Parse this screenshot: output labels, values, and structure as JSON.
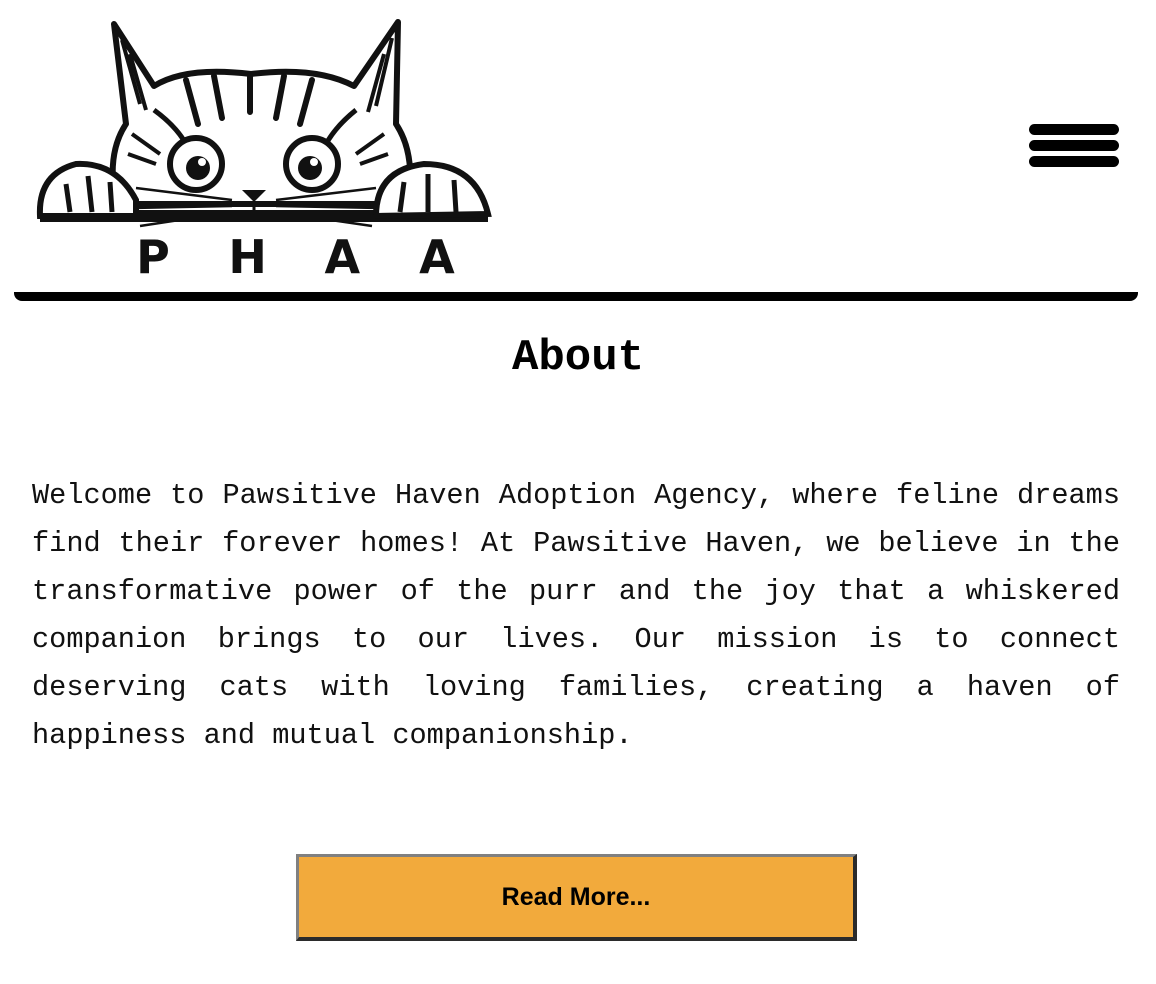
{
  "header": {
    "logo": {
      "letters": [
        "P",
        "H",
        "A",
        "A"
      ],
      "icon": "peeking-cat-logo"
    },
    "menu_icon": "hamburger-menu-icon"
  },
  "main": {
    "title": "About",
    "paragraph": "Welcome to Pawsitive Haven Adoption Agency, where feline dreams find their forever homes! At Pawsitive Haven, we believe in the transformative power of the purr and the joy that a whiskered companion brings to our lives. Our mission is to connect deserving cats with loving families, creating a haven of happiness and mutual companionship.",
    "button_label": "Read More..."
  },
  "colors": {
    "button_background": "#f2aa3c",
    "text": "#000000",
    "divider": "#000000"
  }
}
